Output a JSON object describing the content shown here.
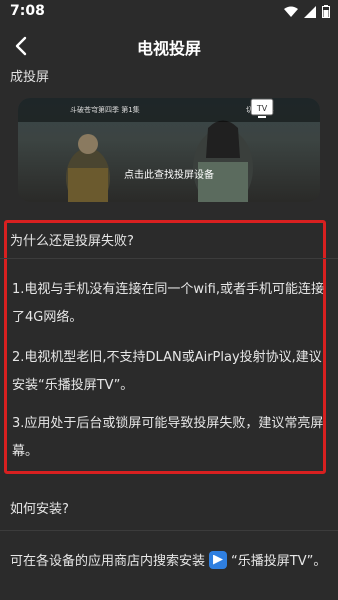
{
  "status": {
    "time": "7:08"
  },
  "nav": {
    "title": "电视投屏"
  },
  "section_partial": "成投屏",
  "screenshot": {
    "video_title": "斗破苍穹第四季 第1集",
    "video_button": "切换线路",
    "hint": "点击此查找投屏设备",
    "tv_label": "TV"
  },
  "faq": {
    "question": "为什么还是投屏失败?",
    "items": [
      "1.电视与手机没有连接在同一个wifi,或者手机可能连接了4G网络。",
      "2.电视机型老旧,不支持DLAN或AirPlay投射协议,建议安装“乐播投屏TV”。",
      "3.应用处于后台或锁屏可能导致投屏失败，建议常亮屏幕。"
    ]
  },
  "install": {
    "question": "如何安装?",
    "text_before": "可在各设备的应用商店内搜索安装",
    "text_after": "“乐播投屏TV”。"
  },
  "colors": {
    "highlight": "#d82020",
    "background": "#2b2b2b"
  }
}
